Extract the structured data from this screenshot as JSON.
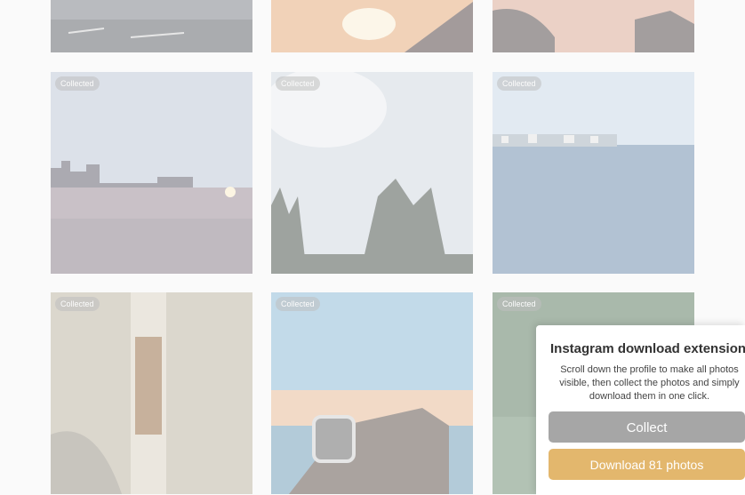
{
  "tiles": [
    {
      "badge": ""
    },
    {
      "badge": ""
    },
    {
      "badge": ""
    },
    {
      "badge": "Collected"
    },
    {
      "badge": "Collected"
    },
    {
      "badge": "Collected"
    },
    {
      "badge": "Collected"
    },
    {
      "badge": "Collected"
    },
    {
      "badge": "Collected"
    }
  ],
  "panel": {
    "title": "Instagram download extension",
    "description": "Scroll down the profile to make all photos visible, then collect the photos and simply download them in one click.",
    "collect_label": "Collect",
    "download_label": "Download 81 photos"
  },
  "colors": {
    "collect_button": "#a6a6a6",
    "download_button": "#e3b76d"
  }
}
